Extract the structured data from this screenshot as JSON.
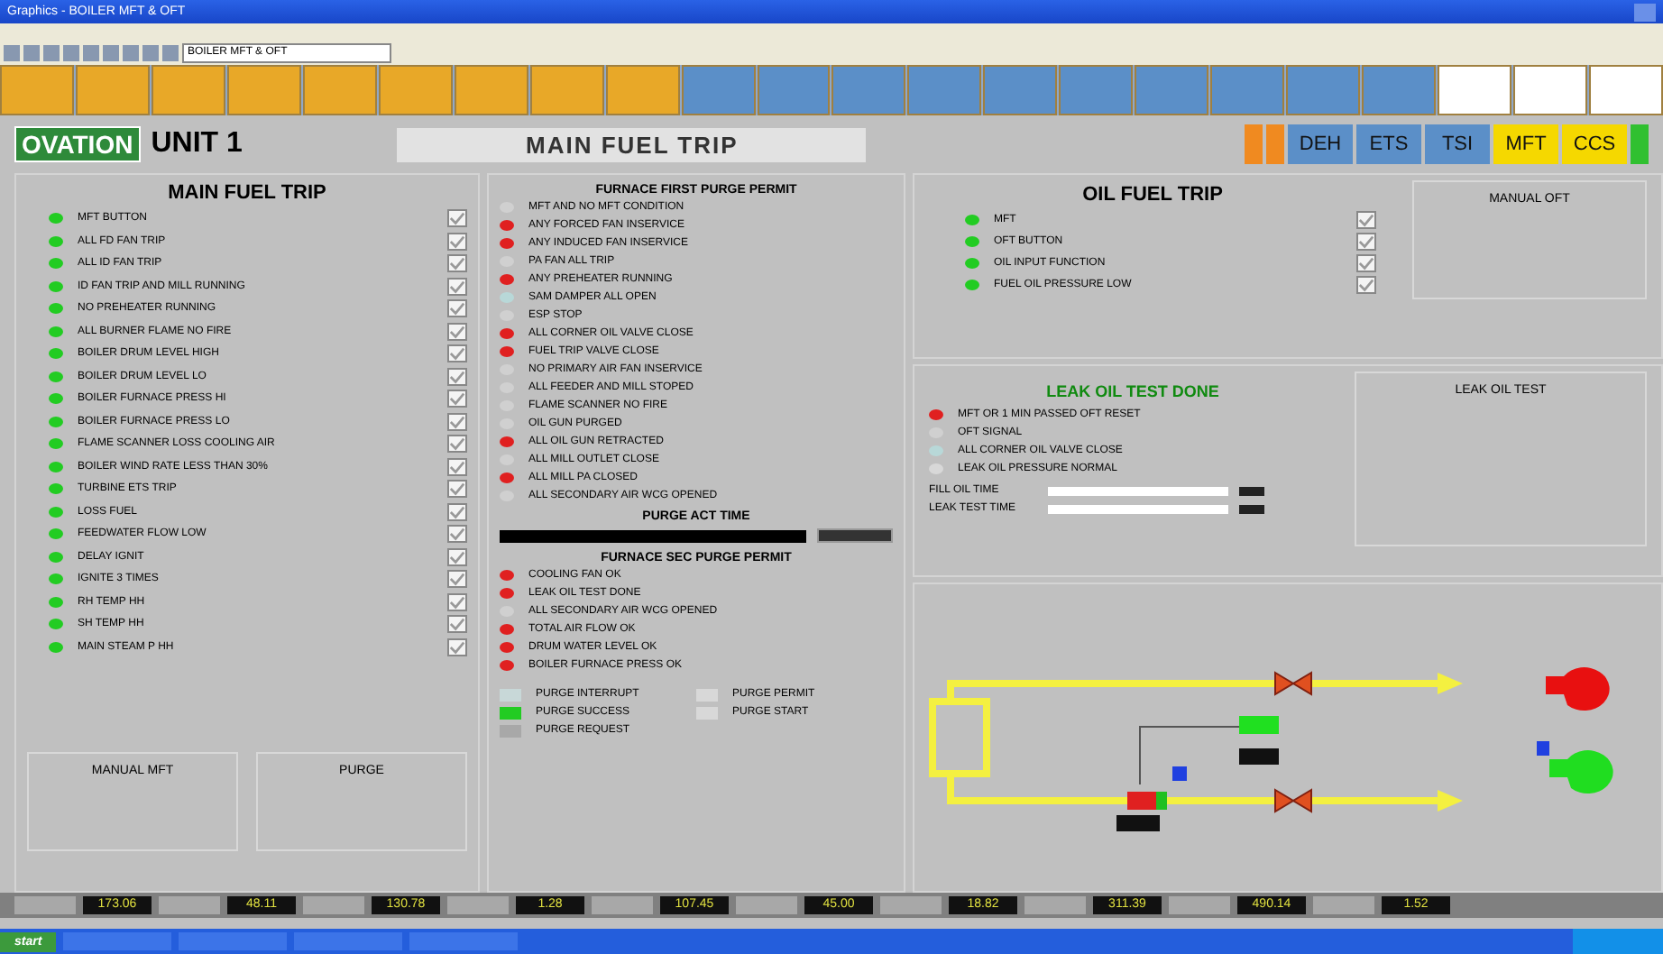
{
  "window": {
    "title": "Graphics - BOILER MFT & OFT"
  },
  "toolbar": {
    "diagram_select": "BOILER MFT & OFT"
  },
  "nav_tabs": [
    {
      "color": "#e8a828"
    },
    {
      "color": "#e8a828"
    },
    {
      "color": "#e8a828"
    },
    {
      "color": "#e8a828"
    },
    {
      "color": "#e8a828"
    },
    {
      "color": "#e8a828"
    },
    {
      "color": "#e8a828"
    },
    {
      "color": "#e8a828"
    },
    {
      "color": "#e8a828"
    },
    {
      "color": "#5b8fc8"
    },
    {
      "color": "#5b8fc8"
    },
    {
      "color": "#5b8fc8"
    },
    {
      "color": "#5b8fc8"
    },
    {
      "color": "#5b8fc8"
    },
    {
      "color": "#5b8fc8"
    },
    {
      "color": "#5b8fc8"
    },
    {
      "color": "#5b8fc8"
    },
    {
      "color": "#5b8fc8"
    },
    {
      "color": "#5b8fc8"
    },
    {
      "color": "#ffffff"
    },
    {
      "color": "#ffffff"
    },
    {
      "color": "#ffffff"
    }
  ],
  "header": {
    "logo": "OVATION",
    "unit": "UNIT 1",
    "title": "MAIN FUEL TRIP",
    "buttons": [
      {
        "color": "#f08a20"
      },
      {
        "color": "#f08a20"
      },
      {
        "label": "DEH",
        "color": "#5b8fc8"
      },
      {
        "label": "ETS",
        "color": "#5b8fc8"
      },
      {
        "label": "TSI",
        "color": "#5b8fc8"
      },
      {
        "label": "MFT",
        "color": "#f5d800"
      },
      {
        "label": "CCS",
        "color": "#f5d800"
      },
      {
        "color": "#30c030"
      }
    ]
  },
  "mft": {
    "title": "MAIN FUEL TRIP",
    "items": [
      {
        "label": "MFT BUTTON",
        "color": "#22cc22",
        "checked": true
      },
      {
        "label": "ALL FD FAN TRIP",
        "color": "#22cc22",
        "checked": true
      },
      {
        "label": "ALL ID FAN TRIP",
        "color": "#22cc22",
        "checked": true
      },
      {
        "label": "ID FAN TRIP AND MILL RUNNING",
        "color": "#22cc22",
        "checked": true
      },
      {
        "label": "NO PREHEATER RUNNING",
        "color": "#22cc22",
        "checked": true
      },
      {
        "label": "ALL BURNER FLAME NO FIRE",
        "color": "#22cc22",
        "checked": true
      },
      {
        "label": "BOILER DRUM LEVEL HIGH",
        "color": "#22cc22",
        "checked": true
      },
      {
        "label": "BOILER DRUM LEVEL LO",
        "color": "#22cc22",
        "checked": true
      },
      {
        "label": "BOILER FURNACE PRESS HI",
        "color": "#22cc22",
        "checked": true
      },
      {
        "label": "BOILER FURNACE PRESS LO",
        "color": "#22cc22",
        "checked": true
      },
      {
        "label": "FLAME SCANNER LOSS COOLING AIR",
        "color": "#22cc22",
        "checked": true
      },
      {
        "label": "BOILER WIND RATE LESS THAN 30%",
        "color": "#22cc22",
        "checked": true
      },
      {
        "label": "TURBINE ETS TRIP",
        "color": "#22cc22",
        "checked": true
      },
      {
        "label": "LOSS FUEL",
        "color": "#22cc22",
        "checked": true
      },
      {
        "label": "FEEDWATER FLOW LOW",
        "color": "#22cc22",
        "checked": true
      },
      {
        "label": "DELAY IGNIT",
        "color": "#22cc22",
        "checked": true
      },
      {
        "label": "IGNITE 3 TIMES",
        "color": "#22cc22",
        "checked": true
      },
      {
        "label": "RH TEMP HH",
        "color": "#22cc22",
        "checked": true
      },
      {
        "label": "SH TEMP HH",
        "color": "#22cc22",
        "checked": true
      },
      {
        "label": "MAIN STEAM P HH",
        "color": "#22cc22",
        "checked": true
      }
    ],
    "panels": [
      "MANUAL MFT",
      "PURGE"
    ]
  },
  "first_purge": {
    "title": "FURNACE FIRST PURGE PERMIT",
    "items": [
      {
        "label": "MFT AND NO MFT CONDITION",
        "color": "#d0d0d0"
      },
      {
        "label": "ANY FORCED FAN INSERVICE",
        "color": "#e02020"
      },
      {
        "label": "ANY INDUCED FAN INSERVICE",
        "color": "#e02020"
      },
      {
        "label": "PA FAN ALL TRIP",
        "color": "#d0d0d0"
      },
      {
        "label": "ANY PREHEATER RUNNING",
        "color": "#e02020"
      },
      {
        "label": "SAM DAMPER ALL OPEN",
        "color": "#b8d8d8"
      },
      {
        "label": "ESP STOP",
        "color": "#d0d0d0"
      },
      {
        "label": "ALL CORNER OIL VALVE CLOSE",
        "color": "#e02020"
      },
      {
        "label": "FUEL TRIP VALVE CLOSE",
        "color": "#e02020"
      },
      {
        "label": "NO PRIMARY AIR FAN INSERVICE",
        "color": "#d0d0d0"
      },
      {
        "label": "ALL FEEDER AND MILL STOPED",
        "color": "#d0d0d0"
      },
      {
        "label": "FLAME SCANNER NO FIRE",
        "color": "#d0d0d0"
      },
      {
        "label": "OIL GUN PURGED",
        "color": "#d0d0d0"
      },
      {
        "label": "ALL OIL GUN RETRACTED",
        "color": "#e02020"
      },
      {
        "label": "ALL MILL OUTLET CLOSE",
        "color": "#d0d0d0"
      },
      {
        "label": "ALL MILL PA CLOSED",
        "color": "#e02020"
      },
      {
        "label": "ALL SECONDARY AIR WCG OPENED",
        "color": "#d0d0d0"
      }
    ],
    "timer_title": "PURGE ACT TIME"
  },
  "sec_purge": {
    "title": "FURNACE SEC PURGE PERMIT",
    "items": [
      {
        "label": "COOLING FAN OK",
        "color": "#e02020"
      },
      {
        "label": "LEAK OIL TEST DONE",
        "color": "#e02020"
      },
      {
        "label": "ALL SECONDARY AIR WCG OPENED",
        "color": "#d0d0d0"
      },
      {
        "label": "TOTAL AIR FLOW OK",
        "color": "#e02020"
      },
      {
        "label": "DRUM WATER LEVEL OK",
        "color": "#e02020"
      },
      {
        "label": "BOILER FURNACE PRESS OK",
        "color": "#e02020"
      }
    ],
    "status": [
      {
        "label": "PURGE INTERRUPT",
        "color": "#c8d8d8"
      },
      {
        "label": "PURGE PERMIT",
        "color": "#d8d8d8"
      },
      {
        "label": "PURGE SUCCESS",
        "color": "#22cc22"
      },
      {
        "label": "PURGE START",
        "color": "#d8d8d8"
      },
      {
        "label": "PURGE REQUEST",
        "color": "#a8a8a8"
      }
    ]
  },
  "oft": {
    "title": "OIL FUEL TRIP",
    "items": [
      {
        "label": "MFT",
        "color": "#22cc22",
        "checked": true
      },
      {
        "label": "OFT BUTTON",
        "color": "#22cc22",
        "checked": true
      },
      {
        "label": "OIL INPUT FUNCTION",
        "color": "#22cc22",
        "checked": true
      },
      {
        "label": "FUEL OIL PRESSURE LOW",
        "color": "#22cc22",
        "checked": true
      }
    ],
    "panel": "MANUAL OFT"
  },
  "leak_test": {
    "title": "LEAK OIL TEST DONE",
    "items": [
      {
        "label": "MFT OR 1 MIN PASSED OFT RESET",
        "color": "#e02020"
      },
      {
        "label": "OFT SIGNAL",
        "color": "#d0d0d0"
      },
      {
        "label": "ALL CORNER OIL VALVE CLOSE",
        "color": "#b8d8d8"
      },
      {
        "label": "LEAK OIL PRESSURE NORMAL",
        "color": "#d8d8d8"
      }
    ],
    "timers": [
      {
        "label": "FILL OIL TIME"
      },
      {
        "label": "LEAK TEST TIME"
      }
    ],
    "panel": "LEAK OIL TEST"
  },
  "status_bar": [
    "173.06",
    "48.11",
    "130.78",
    "1.28",
    "107.45",
    "45.00",
    "18.82",
    "311.39",
    "490.14",
    "1.52"
  ],
  "taskbar": {
    "start": "start"
  }
}
